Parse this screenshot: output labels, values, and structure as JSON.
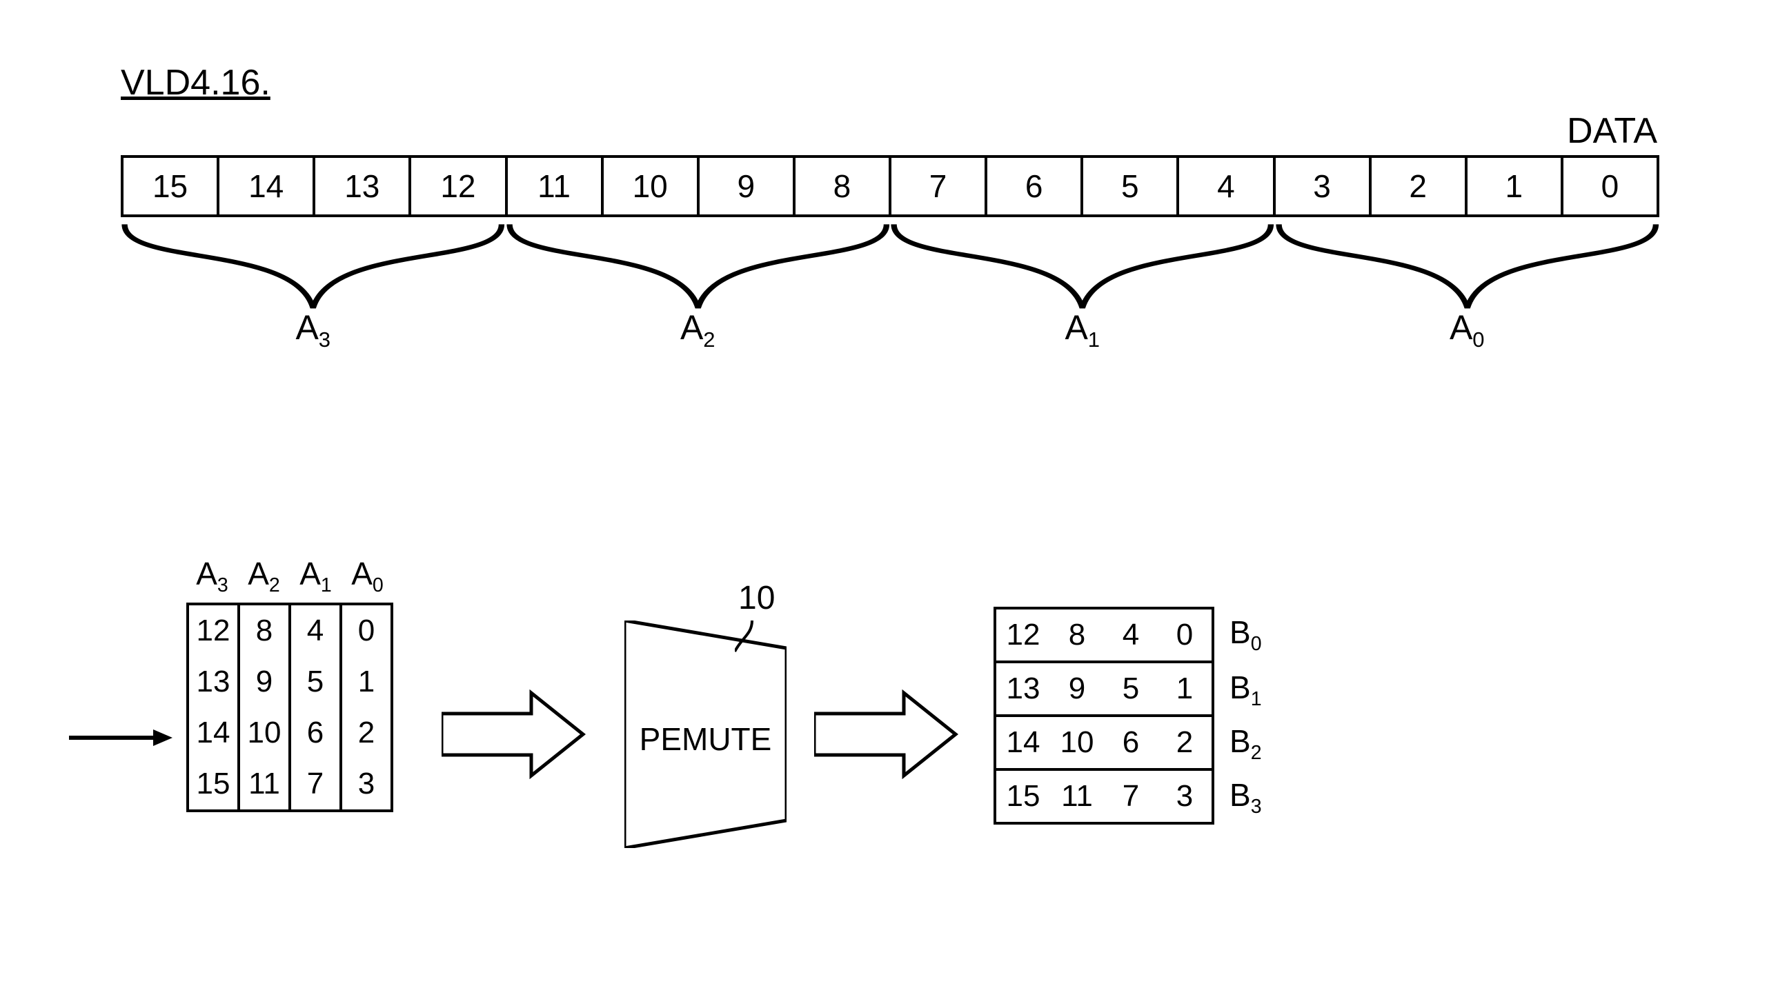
{
  "title": "VLD4.16.",
  "data_label": "DATA",
  "strip": [
    "15",
    "14",
    "13",
    "12",
    "11",
    "10",
    "9",
    "8",
    "7",
    "6",
    "5",
    "4",
    "3",
    "2",
    "1",
    "0"
  ],
  "group_labels": [
    "A",
    "A",
    "A",
    "A"
  ],
  "group_subs": [
    "3",
    "2",
    "1",
    "0"
  ],
  "A_headers": [
    "A",
    "A",
    "A",
    "A"
  ],
  "A_headers_sub": [
    "3",
    "2",
    "1",
    "0"
  ],
  "A_cols": [
    [
      "12",
      "13",
      "14",
      "15"
    ],
    [
      "8",
      "9",
      "10",
      "11"
    ],
    [
      "4",
      "5",
      "6",
      "7"
    ],
    [
      "0",
      "1",
      "2",
      "3"
    ]
  ],
  "permute_label": "PEMUTE",
  "permute_ref": "10",
  "B_rows": [
    {
      "cells": [
        "12",
        "8",
        "4",
        "0"
      ],
      "lbl": "B",
      "sub": "0"
    },
    {
      "cells": [
        "13",
        "9",
        "5",
        "1"
      ],
      "lbl": "B",
      "sub": "1"
    },
    {
      "cells": [
        "14",
        "10",
        "6",
        "2"
      ],
      "lbl": "B",
      "sub": "2"
    },
    {
      "cells": [
        "15",
        "11",
        "7",
        "3"
      ],
      "lbl": "B",
      "sub": "3"
    }
  ]
}
